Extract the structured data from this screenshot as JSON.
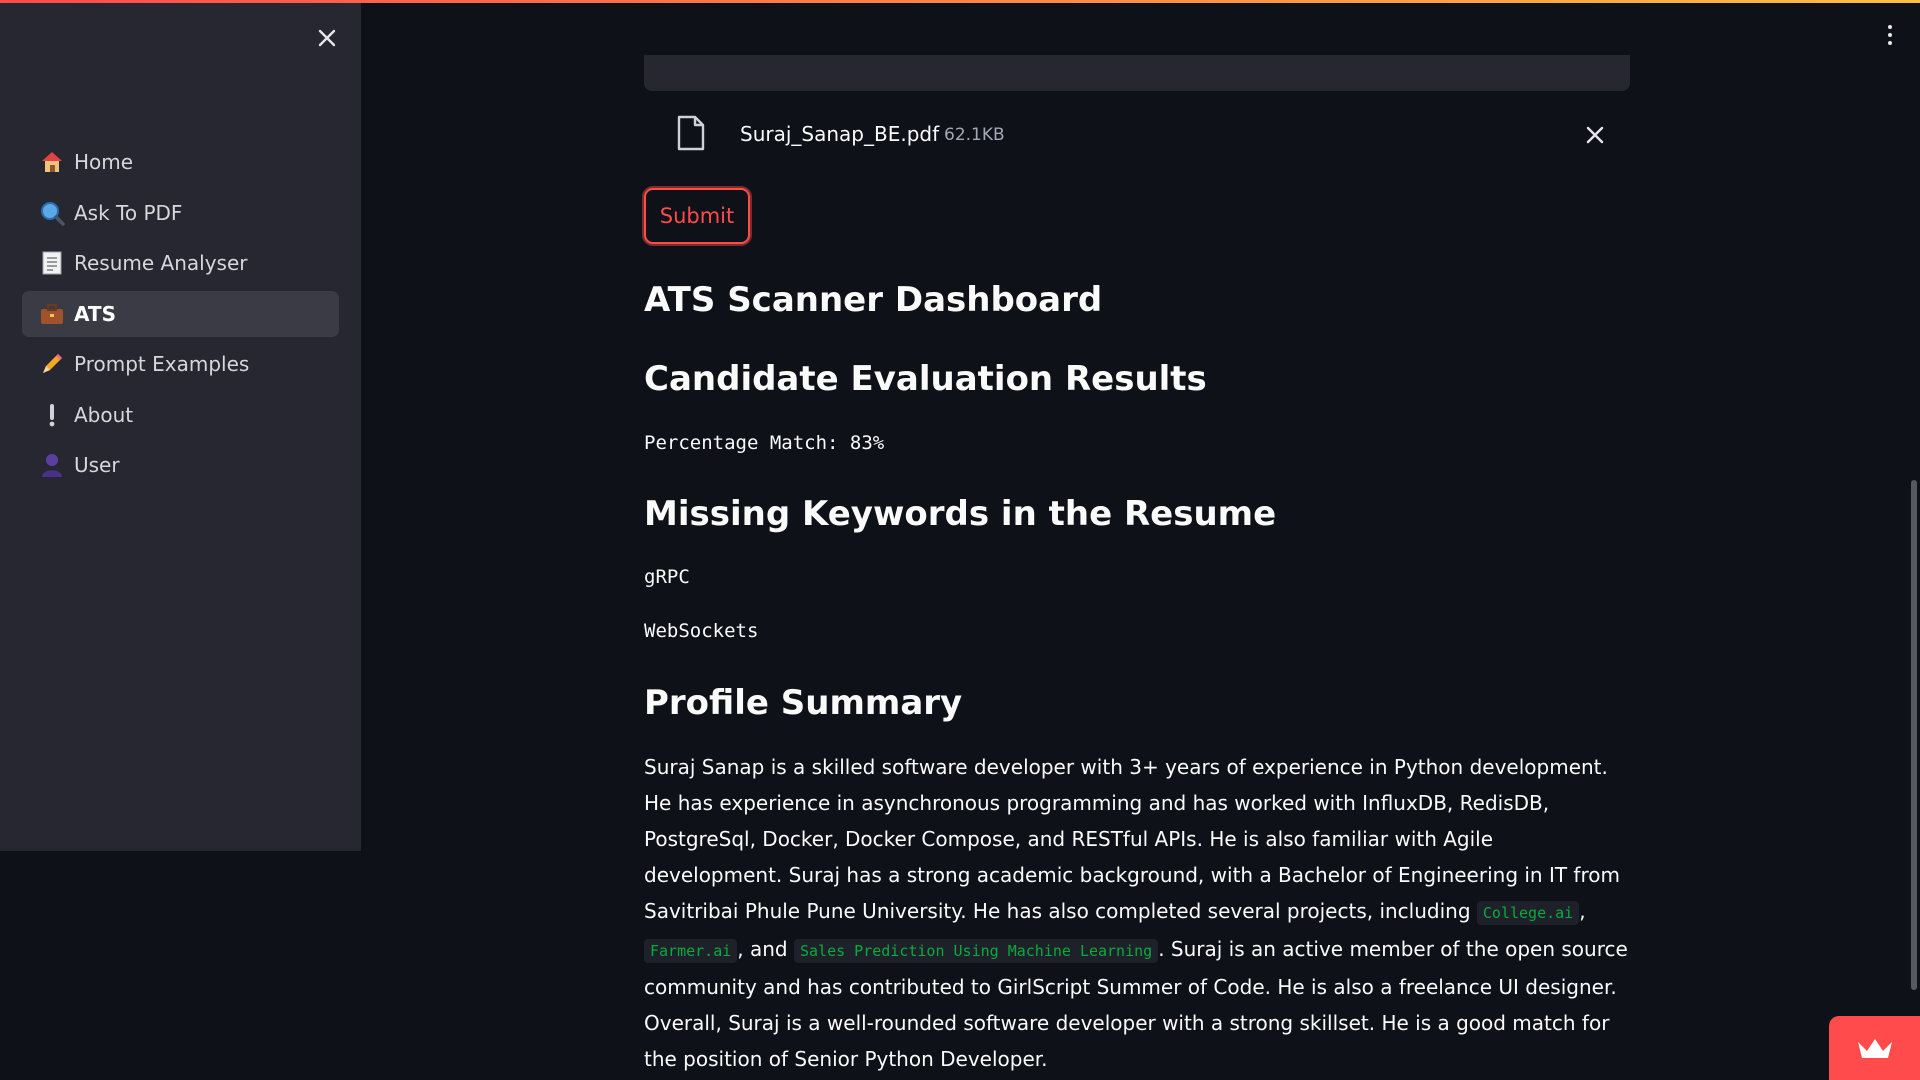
{
  "colors": {
    "accent": "#ff4b4b",
    "sidebar_bg": "#262730",
    "page_bg": "#0e1117",
    "code_text": "#09ab3b"
  },
  "sidebar": {
    "items": [
      {
        "label": "Home",
        "icon": "house-icon"
      },
      {
        "label": "Ask To PDF",
        "icon": "magnifier-icon"
      },
      {
        "label": "Resume Analyser",
        "icon": "document-icon"
      },
      {
        "label": "ATS",
        "icon": "briefcase-icon",
        "active": true
      },
      {
        "label": "Prompt Examples",
        "icon": "pencil-icon"
      },
      {
        "label": "About",
        "icon": "exclamation-icon"
      },
      {
        "label": "User",
        "icon": "user-icon"
      }
    ]
  },
  "upload": {
    "file_name": "Suraj_Sanap_BE.pdf",
    "file_size": "62.1KB"
  },
  "submit_label": "Submit",
  "headings": {
    "dashboard": "ATS Scanner Dashboard",
    "results": "Candidate Evaluation Results",
    "missing": "Missing Keywords in the Resume",
    "profile": "Profile Summary"
  },
  "percentage_match": "Percentage Match: 83%",
  "missing_keywords": [
    "gRPC",
    "WebSockets"
  ],
  "summary": {
    "part1": "Suraj Sanap is a skilled software developer with 3+ years of experience in Python development. He has experience in asynchronous programming and has worked with InfluxDB, RedisDB, PostgreSql, Docker, Docker Compose, and RESTful APIs. He is also familiar with Agile development. Suraj has a strong academic background, with a Bachelor of Engineering in IT from Savitribai Phule Pune University. He has also completed several projects, including ",
    "code1": "College.ai",
    "sep1": ", ",
    "code2": "Farmer.ai",
    "sep2": ", and ",
    "code3": "Sales Prediction Using Machine Learning",
    "part2": ". Suraj is an active member of the open source community and has contributed to GirlScript Summer of Code. He is also a freelance UI designer. Overall, Suraj is a well-rounded software developer with a strong skillset. He is a good match for the position of Senior Python Developer."
  }
}
